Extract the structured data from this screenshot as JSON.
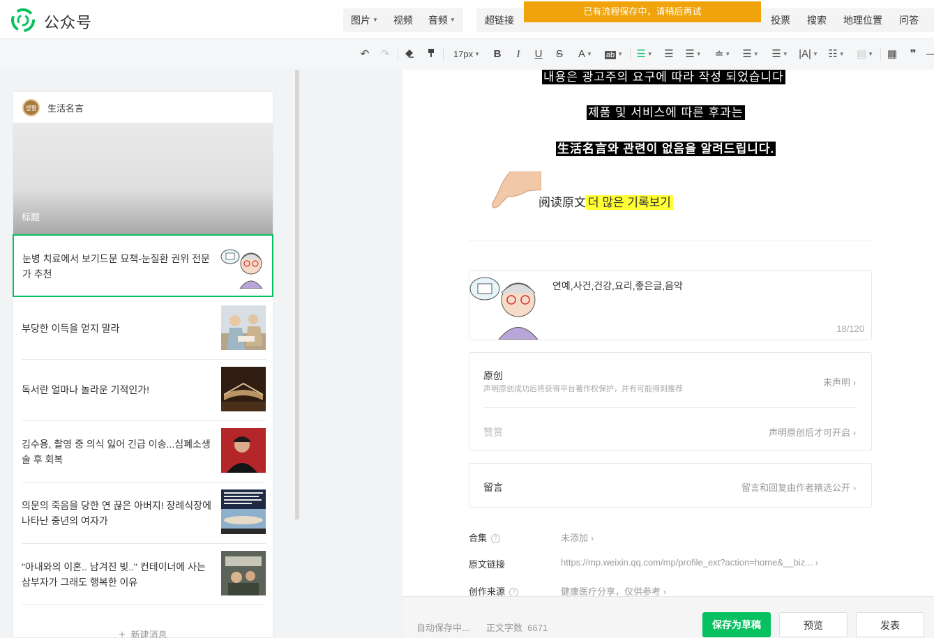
{
  "header": {
    "brand": "公众号",
    "media_tools": [
      {
        "label": "图片",
        "caret": true
      },
      {
        "label": "视频",
        "caret": false
      },
      {
        "label": "音频",
        "caret": true
      }
    ],
    "insert_tools": [
      {
        "label": "超链接"
      },
      {
        "label": "投票"
      },
      {
        "label": "搜索"
      },
      {
        "label": "地理位置"
      },
      {
        "label": "问答"
      }
    ],
    "toast": "已有流程保存中，请稍后再试"
  },
  "toolbar": {
    "font_size": "17px",
    "bold": "B",
    "italic": "I",
    "underline": "U",
    "strike": "S",
    "font_color": "A",
    "bg_color": "ab"
  },
  "sidebar": {
    "account_name": "生活名言",
    "avatar_text": "생활",
    "cover_title": "标题",
    "articles": [
      {
        "title": "눈병 치료에서 보기드문 묘책-눈질환 권위 전문가 추천",
        "thumb": "cartoon-doctor"
      },
      {
        "title": "부당한 이득을 얻지 말라",
        "thumb": "historical-painting"
      },
      {
        "title": "독서란 얼마나 놀라운 기적인가!",
        "thumb": "open-book"
      },
      {
        "title": "김수용, 촬영 중 의식 잃어 긴급 이송...심폐소생술 후 회복",
        "thumb": "man-portrait"
      },
      {
        "title": "의문의 죽음을 당한 연 끊은 아버지! 장례식장에 나타난 중년의 여자가",
        "thumb": "sky-text"
      },
      {
        "title": "\"아내와의 이혼.. 남겨진 빚..\" 컨테이너에 사는 삼부자가 그래도 행복한 이유",
        "thumb": "street-scene"
      }
    ],
    "new_message": "新建消息"
  },
  "editor": {
    "line1": "내용은 광고주의 요구에 따라 작성 되었습니다",
    "line2": "제품 및 서비스에 따른 후과는",
    "line3": "生活名言와 관련이 없음을 알려드립니다.",
    "read_original": "阅读原文",
    "read_more": "더 많은 기록보기",
    "summary": "연예,사건,건강,요리,좋은글,음악",
    "summary_count": "18/120",
    "original_label": "原创",
    "original_desc": "声明原创成功后将获得平台著作权保护，并有可能得到推荐",
    "original_status": "未声明",
    "reward_label": "赞赏",
    "reward_status": "声明原创后才可开启",
    "comment_label": "留言",
    "comment_status": "留言和回复由作者精选公开",
    "collection_label": "合集",
    "collection_value": "未添加",
    "source_link_label": "原文链接",
    "source_link_value": "https://mp.weixin.qq.com/mp/profile_ext?action=home&__biz...",
    "creation_source_label": "创作来源",
    "creation_source_value": "健康医疗分享，仅供参考"
  },
  "footer": {
    "autosave": "自动保存中...",
    "word_count_label": "正文字数",
    "word_count": "6671",
    "save_draft": "保存为草稿",
    "preview": "预览",
    "publish": "发表"
  },
  "colors": {
    "brand_green": "#07c160",
    "toast_orange": "#f0a30a",
    "highlight_yellow": "#ffff33"
  }
}
